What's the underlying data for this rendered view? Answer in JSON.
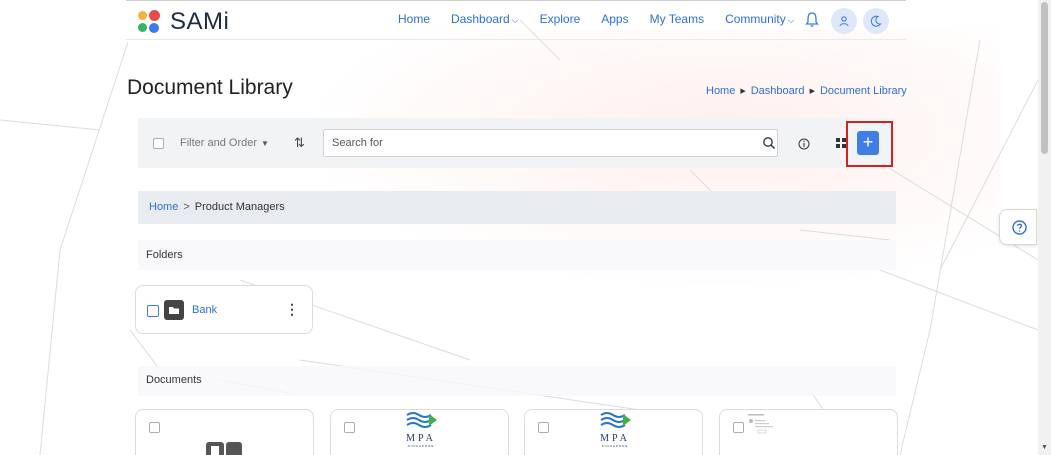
{
  "app": {
    "name": "SAMi"
  },
  "nav": {
    "items": [
      {
        "label": "Home"
      },
      {
        "label": "Dashboard",
        "has_dropdown": true
      },
      {
        "label": "Explore"
      },
      {
        "label": "Apps"
      },
      {
        "label": "My Teams"
      },
      {
        "label": "Community",
        "has_dropdown": true
      }
    ],
    "icons": [
      "bell-icon",
      "user-icon",
      "moon-icon"
    ]
  },
  "page": {
    "title": "Document Library",
    "breadcrumb": [
      "Home",
      "Dashboard",
      "Document Library"
    ]
  },
  "toolbar": {
    "filter_label": "Filter and Order",
    "search_placeholder": "Search for",
    "add_label": "+"
  },
  "path": {
    "home": "Home",
    "current": "Product Managers"
  },
  "folders": {
    "heading": "Folders",
    "items": [
      {
        "name": "Bank"
      }
    ]
  },
  "documents": {
    "heading": "Documents",
    "logo_text": "MPA",
    "logo_sub": "SINGAPORE"
  },
  "colors": {
    "accent": "#3f7ee8",
    "link": "#2f6fd6",
    "highlight_box": "#d62020"
  }
}
